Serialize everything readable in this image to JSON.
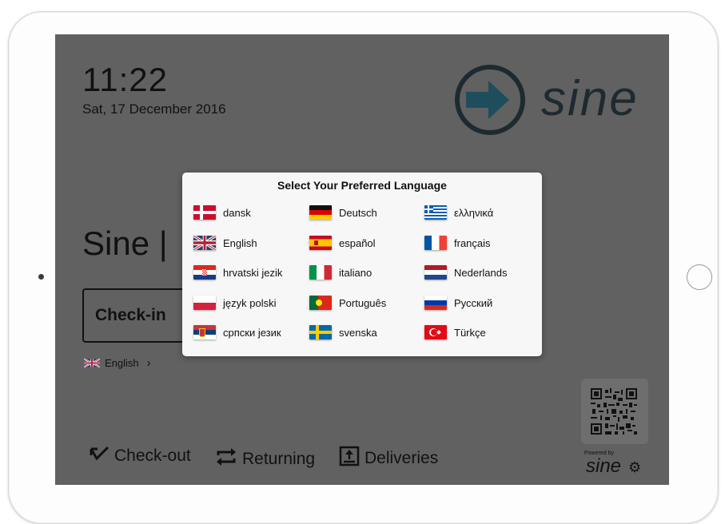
{
  "clock": {
    "time": "11:22",
    "date": "Sat, 17 December 2016"
  },
  "brand": {
    "name": "sine",
    "powered_by": "Powered by",
    "footer_logo": "sine"
  },
  "welcome": {
    "text": "Sine |"
  },
  "main": {
    "checkin_label": "Check-in",
    "language_label": "English",
    "language_chevron": "›"
  },
  "bottom_actions": [
    {
      "label": "Check-out",
      "icon": "arrow-down-left-icon"
    },
    {
      "label": "Returning",
      "icon": "repeat-icon"
    },
    {
      "label": "Deliveries",
      "icon": "tray-arrow-icon"
    }
  ],
  "language_modal": {
    "title": "Select Your Preferred Language",
    "languages": [
      {
        "label": "dansk",
        "flag": "denmark"
      },
      {
        "label": "Deutsch",
        "flag": "germany"
      },
      {
        "label": "ελληνικά",
        "flag": "greece"
      },
      {
        "label": "English",
        "flag": "uk"
      },
      {
        "label": "español",
        "flag": "spain"
      },
      {
        "label": "français",
        "flag": "france"
      },
      {
        "label": "hrvatski jezik",
        "flag": "croatia"
      },
      {
        "label": "italiano",
        "flag": "italy"
      },
      {
        "label": "Nederlands",
        "flag": "netherlands"
      },
      {
        "label": "język polski",
        "flag": "poland"
      },
      {
        "label": "Português",
        "flag": "portugal"
      },
      {
        "label": "Русский",
        "flag": "russia"
      },
      {
        "label": "српски језик",
        "flag": "serbia"
      },
      {
        "label": "svenska",
        "flag": "sweden"
      },
      {
        "label": "Türkçe",
        "flag": "turkey"
      }
    ]
  },
  "colors": {
    "screen_overlay": "#616161",
    "modal_bg": "#f7f7f7",
    "logo_dark": "#1f2a30",
    "logo_arrow": "#1e4d5c"
  }
}
